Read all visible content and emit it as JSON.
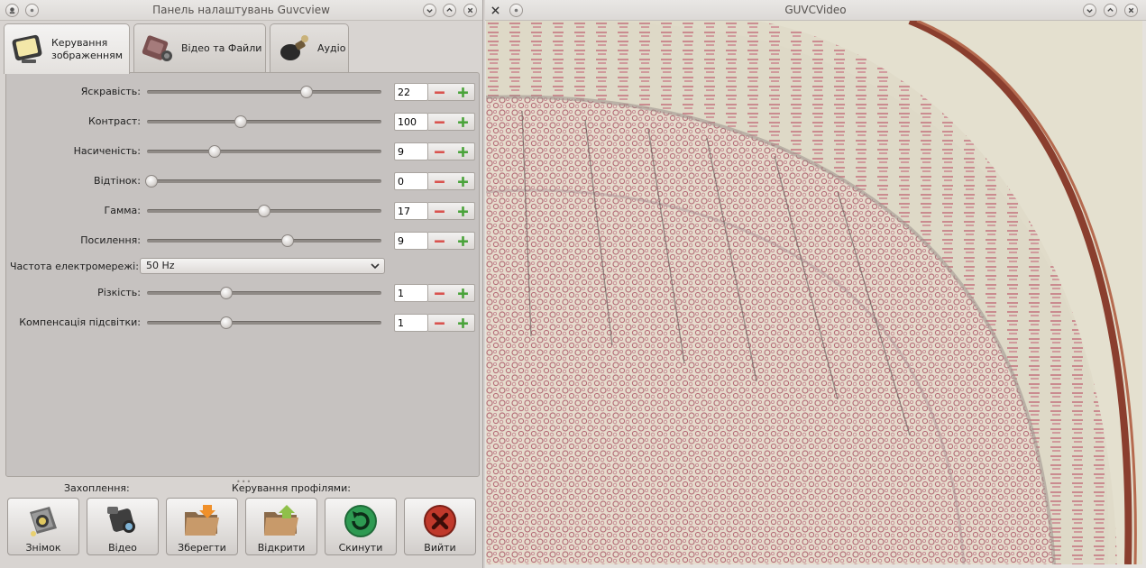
{
  "panel": {
    "title": "Панель налаштувань Guvcview",
    "tabs": [
      {
        "label_line1": "Керування",
        "label_line2": "зображенням",
        "icon": "monitor-icon",
        "active": true
      },
      {
        "label_line1": "Відео та Файли",
        "icon": "video-camera-icon",
        "active": false
      },
      {
        "label_line1": "Аудіо",
        "icon": "microphone-icon",
        "active": false
      }
    ],
    "controls": [
      {
        "label": "Яскравість:",
        "value": "22",
        "slider_fraction": 0.68
      },
      {
        "label": "Контраст:",
        "value": "100",
        "slider_fraction": 0.4
      },
      {
        "label": "Насиченість:",
        "value": "9",
        "slider_fraction": 0.29
      },
      {
        "label": "Відтінок:",
        "value": "0",
        "slider_fraction": 0.02
      },
      {
        "label": "Гамма:",
        "value": "17",
        "slider_fraction": 0.5
      },
      {
        "label": "Посилення:",
        "value": "9",
        "slider_fraction": 0.6
      },
      {
        "label": "Різкість:",
        "value": "1",
        "slider_fraction": 0.34
      },
      {
        "label": "Компенсація підсвітки:",
        "value": "1",
        "slider_fraction": 0.34
      }
    ],
    "powerline": {
      "label": "Частота електромережі:",
      "selected": "50 Hz"
    },
    "capture_label": "Захоплення:",
    "profiles_label": "Керування профілями:",
    "buttons": {
      "snapshot": "Знімок",
      "video": "Відео",
      "save": "Зберегти",
      "open": "Відкрити",
      "reset": "Скинути",
      "quit": "Вийти"
    }
  },
  "video": {
    "title": "GUVCVideo"
  },
  "colors": {
    "accent_minus": "#d9534f",
    "accent_plus": "#4aa33a",
    "reset_green": "#2e9a52",
    "quit_red": "#c0392b"
  }
}
